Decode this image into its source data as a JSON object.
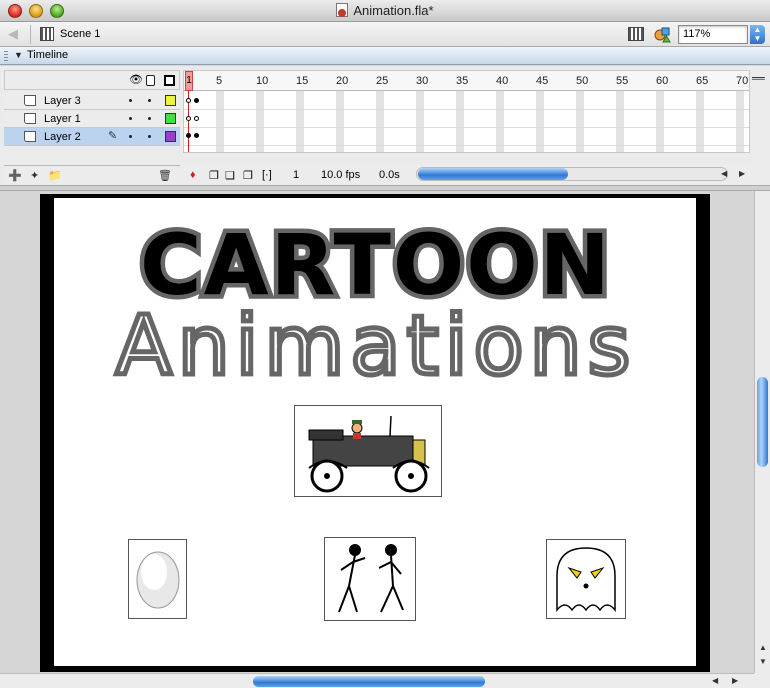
{
  "window": {
    "title": "Animation.fla*"
  },
  "editbar": {
    "scene_label": "Scene 1",
    "zoom_value": "117%"
  },
  "panel": {
    "title": "Timeline"
  },
  "timeline": {
    "layers": [
      {
        "name": "Layer 3",
        "color": "#f0f040",
        "selected": false
      },
      {
        "name": "Layer 1",
        "color": "#40e040",
        "selected": false
      },
      {
        "name": "Layer 2",
        "color": "#9a40c8",
        "selected": true
      }
    ],
    "ruler": [
      "1",
      "5",
      "10",
      "15",
      "20",
      "25",
      "30",
      "35",
      "40",
      "45",
      "50",
      "55",
      "60",
      "65",
      "70"
    ],
    "current_frame": "1",
    "frame_rate": "10.0 fps",
    "elapsed_time": "0.0s"
  },
  "stage": {
    "title_text": "CARTOON",
    "subtitle_text": "Animations"
  },
  "icons": {
    "eye": "eye-icon",
    "lock": "lock-icon",
    "outline": "outline-icon",
    "pencil": "pencil-icon",
    "trash": "trash-icon",
    "scene": "scene-icon"
  }
}
